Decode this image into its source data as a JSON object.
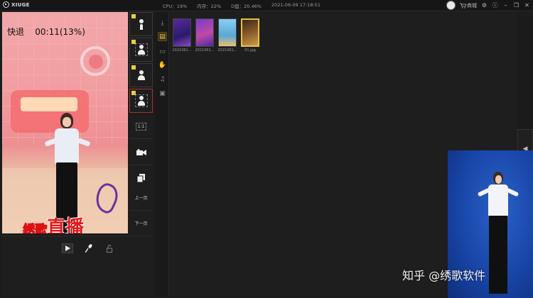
{
  "app": {
    "logo_text": "XIUGE"
  },
  "stats": {
    "cpu": "CPU：19%",
    "memory": "内存：22%",
    "disk": "D盘：20.46%",
    "datetime": "2021-06-09 17:18:51"
  },
  "titlebar": {
    "store_label": "商城"
  },
  "preview": {
    "status_text": "快退    00:11(13%)",
    "caption_small": "绣歌",
    "caption_big": "直播"
  },
  "side_buttons": {
    "aspect_label": "1:1",
    "prev_page": "上一页",
    "next_page": "下一页"
  },
  "media": {
    "items": [
      {
        "label": "2021061..."
      },
      {
        "label": "2021061..."
      },
      {
        "label": "2021061..."
      },
      {
        "label": "01.jpg"
      }
    ]
  },
  "watermark": "知乎 @绣歌软件",
  "colors": {
    "accent": "#e8c33a",
    "active_border": "#b03030",
    "caption_red": "#e01a1a",
    "camera_blue": "#1845a8"
  }
}
